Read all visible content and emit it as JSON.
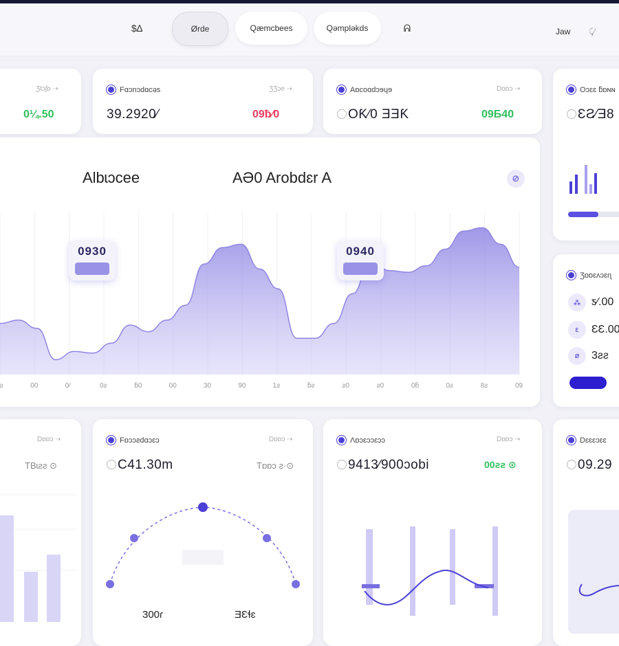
{
  "nav": {
    "logo": "$∆",
    "pills": [
      "Ørde",
      "Qæmcbees",
      "Qəmpləkds"
    ],
    "icon": "ᕱ",
    "right_label": "Jaw",
    "right_icon": "⤹⁄"
  },
  "stats_top": [
    {
      "title": "",
      "meta": "Ʒtɔʃɒ ⇢",
      "value": "",
      "change": "0¼.50",
      "change_color": "green"
    },
    {
      "title": "Fɑɔnɔdɑcəs",
      "meta": "ƷƷɔe ⇢",
      "value": "39.2920⁄",
      "change": "09ƀ⁄0",
      "change_color": "red"
    },
    {
      "title": "Aɒcoɑdɔɘɥɘ",
      "meta": "Dɒɒɔ ⇢",
      "value": "OƘ⁄0 ƎƎƘ",
      "change": "09Ƃ40",
      "change_color": "green"
    },
    {
      "title": "Oɔɛɛ ƃɒɴɴ",
      "meta": "",
      "value": "ƐƧ⁄Ǝ8",
      "change": "",
      "change_color": "green"
    }
  ],
  "main_chart": {
    "title_left": "Albɩɔcee",
    "title_right": "AƏ0 Arobdɛr A",
    "button_icon": "⊘",
    "tooltips": [
      "0930",
      "0940"
    ]
  },
  "chart_data": {
    "type": "area",
    "x": [
      "1ƨ",
      "00",
      "0⁄",
      "0ƨ",
      "ƃ0",
      "00",
      "30",
      "90",
      "1ƨ",
      "ƃƨ",
      "ƨ0",
      "ƨ0",
      "0ƃ",
      "0ƨ",
      "8ƨ",
      "09"
    ],
    "values": [
      31,
      33,
      28,
      9,
      14,
      13,
      19,
      30,
      26,
      33,
      42,
      67,
      77,
      79,
      64,
      52,
      22,
      22,
      31,
      49,
      69,
      63,
      62,
      66,
      76,
      87,
      89,
      79,
      65
    ],
    "color": "#8f86e3"
  },
  "side_list": {
    "title": "Ʒɒɒɛʌɔɛɳ",
    "items": [
      {
        "icon": "⁂",
        "value": "ƽ⁄.00"
      },
      {
        "icon": "ε",
        "value": "ƐƐ.00"
      },
      {
        "icon": "ø",
        "value": "3ƨƨ"
      }
    ]
  },
  "side_top_progress": 0.55,
  "stats_bottom": [
    {
      "title": "",
      "meta": "Dɒɒɔ ⇢",
      "value": "",
      "change": "TBɩƨƨ ⊙",
      "change_color": "gray"
    },
    {
      "title": "Fɒɔɔƨdɑɔɛɔ",
      "meta": "Dɒɒɔ ⇢",
      "value": "C41.30m",
      "change": "Tɒɒɔ ƨ·⊙",
      "change_color": "gray"
    },
    {
      "title": "Ʌɒɔɛɔɔɛɔɔ",
      "meta": "Dɒɒɔ ⇢",
      "value": "9413⁄900ɔobi",
      "change": "00ƨƨ ⊙",
      "change_color": "green"
    },
    {
      "title": "Dɛɛɛɔɛɛ",
      "meta": "",
      "value": "09.29",
      "change": "",
      "change_color": "green"
    }
  ],
  "gauge": {
    "label_left": "300ɾ",
    "label_right": "ƎƐɬɛ"
  },
  "colors": {
    "accent": "#4b3fd6",
    "green": "#2fbf5e",
    "red": "#ea3f62",
    "area": "#8f86e3",
    "background": "#f1f1f7"
  }
}
